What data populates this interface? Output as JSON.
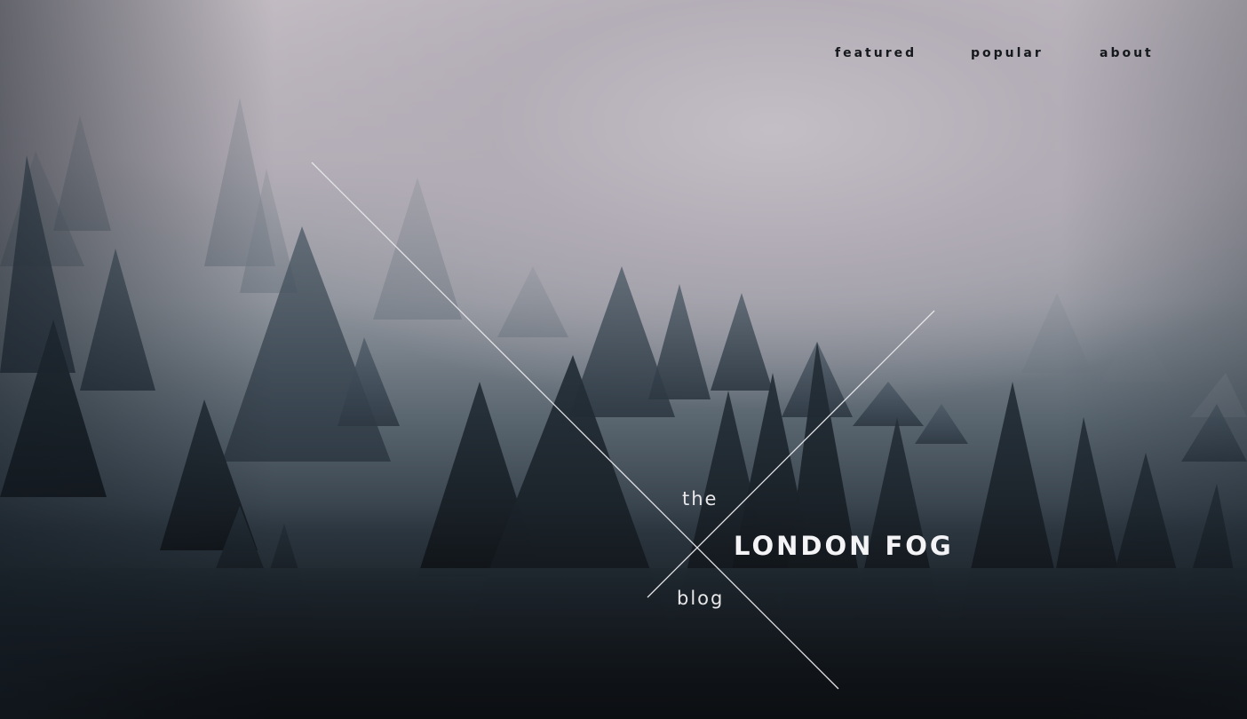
{
  "nav": {
    "items": [
      {
        "label": "featured"
      },
      {
        "label": "popular"
      },
      {
        "label": "about"
      }
    ]
  },
  "logo": {
    "prefix": "the",
    "title": "LONDON FOG",
    "suffix": "blog"
  },
  "colors": {
    "nav_text": "#15181c",
    "logo_text": "#f4f4f6",
    "cross_lines": "#e6e6ea",
    "fog": "#c3bcc3",
    "forest_dark": "#161b21"
  }
}
